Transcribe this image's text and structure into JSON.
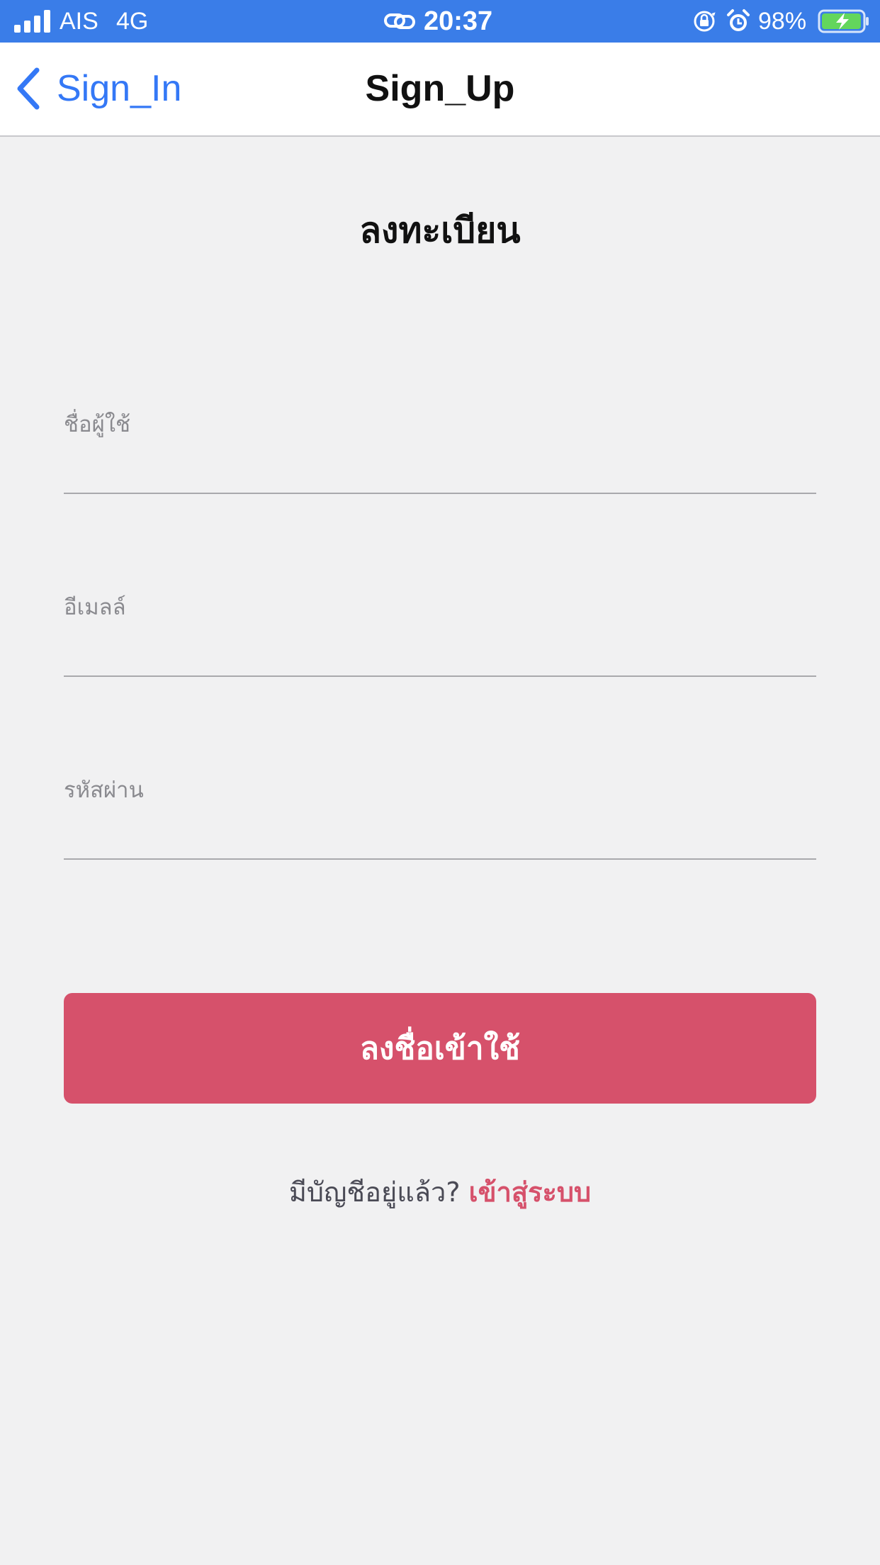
{
  "status_bar": {
    "carrier": "AIS",
    "network": "4G",
    "time": "20:37",
    "battery_percent": "98%",
    "battery_level": 0.98,
    "signal_bars": 4,
    "icons": [
      "signal-icon",
      "link-icon",
      "orientation-lock-icon",
      "alarm-icon",
      "battery-charging-icon"
    ]
  },
  "nav": {
    "back_label": "Sign_In",
    "title": "Sign_Up"
  },
  "form": {
    "heading": "ลงทะเบียน",
    "fields": [
      {
        "label": "ชื่อผู้ใช้",
        "value": ""
      },
      {
        "label": "อีเมลล์",
        "value": ""
      },
      {
        "label": "รหัสผ่าน",
        "value": ""
      }
    ],
    "submit_label": "ลงชื่อเข้าใช้",
    "signin_prompt": "มีบัญชีอยู่แล้ว?",
    "signin_link": "เข้าสู่ระบบ"
  },
  "colors": {
    "status_bar": "#3a7de8",
    "nav_link": "#3478f6",
    "accent": "#d6516b",
    "background": "#f1f1f2"
  }
}
